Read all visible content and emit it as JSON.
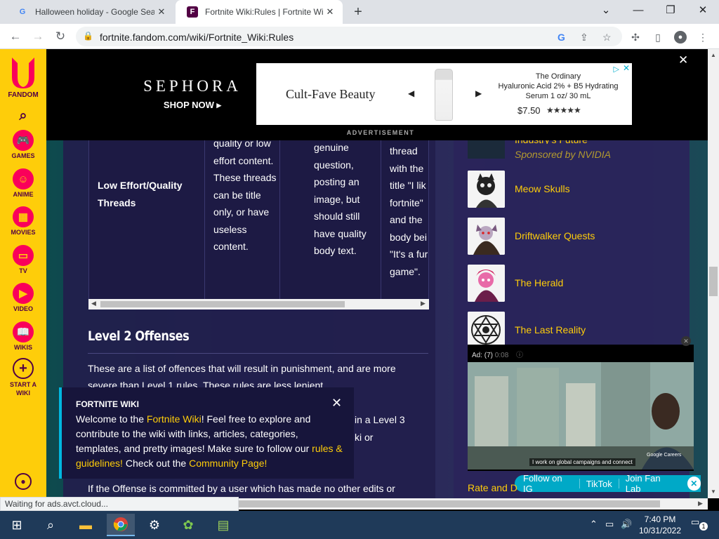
{
  "browser": {
    "tabs": [
      {
        "title": "Halloween holiday - Google Sear",
        "favicon": "google-icon"
      },
      {
        "title": "Fortnite Wiki:Rules | Fortnite Wik",
        "favicon": "fandom-icon"
      }
    ],
    "url": "fortnite.fandom.com/wiki/Fortnite_Wiki:Rules",
    "status": "Waiting for ads.avct.cloud..."
  },
  "rail": {
    "logo_label": "FANDOM",
    "items": [
      {
        "label": "GAMES",
        "icon": "gamepad-icon"
      },
      {
        "label": "ANIME",
        "icon": "anime-icon"
      },
      {
        "label": "MOVIES",
        "icon": "movies-icon"
      },
      {
        "label": "TV",
        "icon": "tv-icon"
      },
      {
        "label": "VIDEO",
        "icon": "video-icon"
      },
      {
        "label": "WIKIS",
        "icon": "wikis-icon"
      },
      {
        "label": "START A WIKI",
        "icon": "plus-icon"
      }
    ]
  },
  "ad": {
    "brand": "SEPHORA",
    "cta": "SHOP NOW",
    "tagline": "Cult-Fave Beauty",
    "product_brand": "The Ordinary",
    "product_name": "Hyaluronic Acid 2% + B5 Hydrating Serum 1 oz/ 30 mL",
    "price": "$7.50",
    "rating": "★★★★★",
    "label": "ADVERTISEMENT"
  },
  "table": {
    "title_cell": "Low Effort/Quality Threads",
    "desc_cell": "quality or low effort content. These threads can be title only, or have useless content.",
    "example_cell": "genuine question, posting an image, but should still have quality body text.",
    "case_cell": "thread with the title \"I lik fortnite\" and the body bei \"It's a fur game\"."
  },
  "content": {
    "section_heading": "Level 2 Offenses",
    "intro": "These are a list of offences that will result in punishment, and are more severe than Level 1 rules. These rules are less lenient",
    "partial_right_1": "in a Level 3",
    "partial_right_2": "ki or",
    "bottom_text": "If the Offense is committed by a user which has made no other edits or"
  },
  "notification": {
    "header": "FORTNITE WIKI",
    "text_1": "Welcome to the ",
    "link_1": "Fortnite Wiki",
    "text_2": "! Feel free to explore and contribute to the wiki with links, articles, categories, templates, and pretty images! Make sure to follow our ",
    "link_2": "rules & guidelines!",
    "text_3": " Check out the ",
    "link_3": "Community Page!"
  },
  "sidebar": {
    "sponsored_title": "Industry's Future",
    "sponsored_by": "Sponsored by NVIDIA",
    "items": [
      {
        "label": "Meow Skulls"
      },
      {
        "label": "Driftwalker Quests"
      },
      {
        "label": "The Herald"
      },
      {
        "label": "The Last Reality"
      }
    ],
    "bottom_link": "Rate and D"
  },
  "video_ad": {
    "header": "Ad: (7)",
    "time": "0:08",
    "caption": "I work on global campaigns and connect",
    "brand": "Google Careers"
  },
  "social": {
    "items": [
      "Follow on IG",
      "TikTok",
      "Join Fan Lab"
    ]
  },
  "taskbar": {
    "time": "7:40 PM",
    "date": "10/31/2022",
    "notif_count": "1"
  },
  "colors": {
    "fandom_yellow": "#fecd0a",
    "fandom_pink": "#fa005a",
    "link_yellow": "#fecd0a",
    "social_teal": "#00a9c7"
  }
}
